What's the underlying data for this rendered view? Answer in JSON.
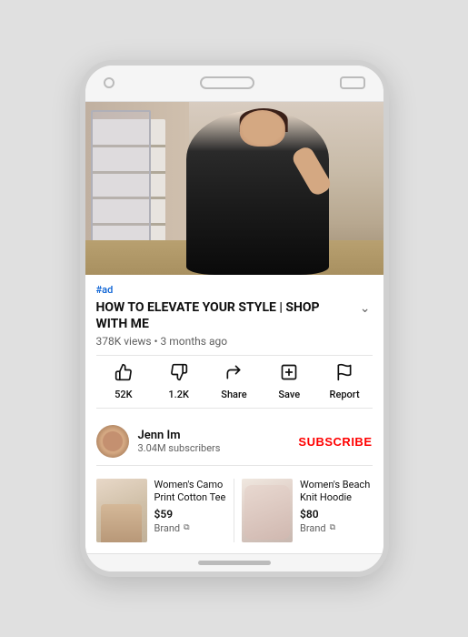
{
  "phone": {
    "ad_label": "#ad",
    "video_title": "HOW TO ELEVATE YOUR STYLE | SHOP WITH ME",
    "video_meta": "378K views • 3 months ago",
    "actions": [
      {
        "icon": "👍",
        "label": "52K",
        "name": "like-button"
      },
      {
        "icon": "👎",
        "label": "1.2K",
        "name": "dislike-button"
      },
      {
        "icon": "↪",
        "label": "Share",
        "name": "share-button"
      },
      {
        "icon": "⊞",
        "label": "Save",
        "name": "save-button"
      },
      {
        "icon": "⚑",
        "label": "Report",
        "name": "report-button"
      }
    ],
    "channel": {
      "name": "Jenn Im",
      "subscribers": "3.04M subscribers",
      "subscribe_label": "SUBSCRIBE"
    },
    "products": [
      {
        "name": "Women's Camo Print Cotton Tee",
        "price": "$59",
        "brand": "Brand",
        "img_class": "product-img-1"
      },
      {
        "name": "Women's Beach Knit Hoodie",
        "price": "$80",
        "brand": "Brand",
        "img_class": "product-img-2"
      }
    ]
  }
}
